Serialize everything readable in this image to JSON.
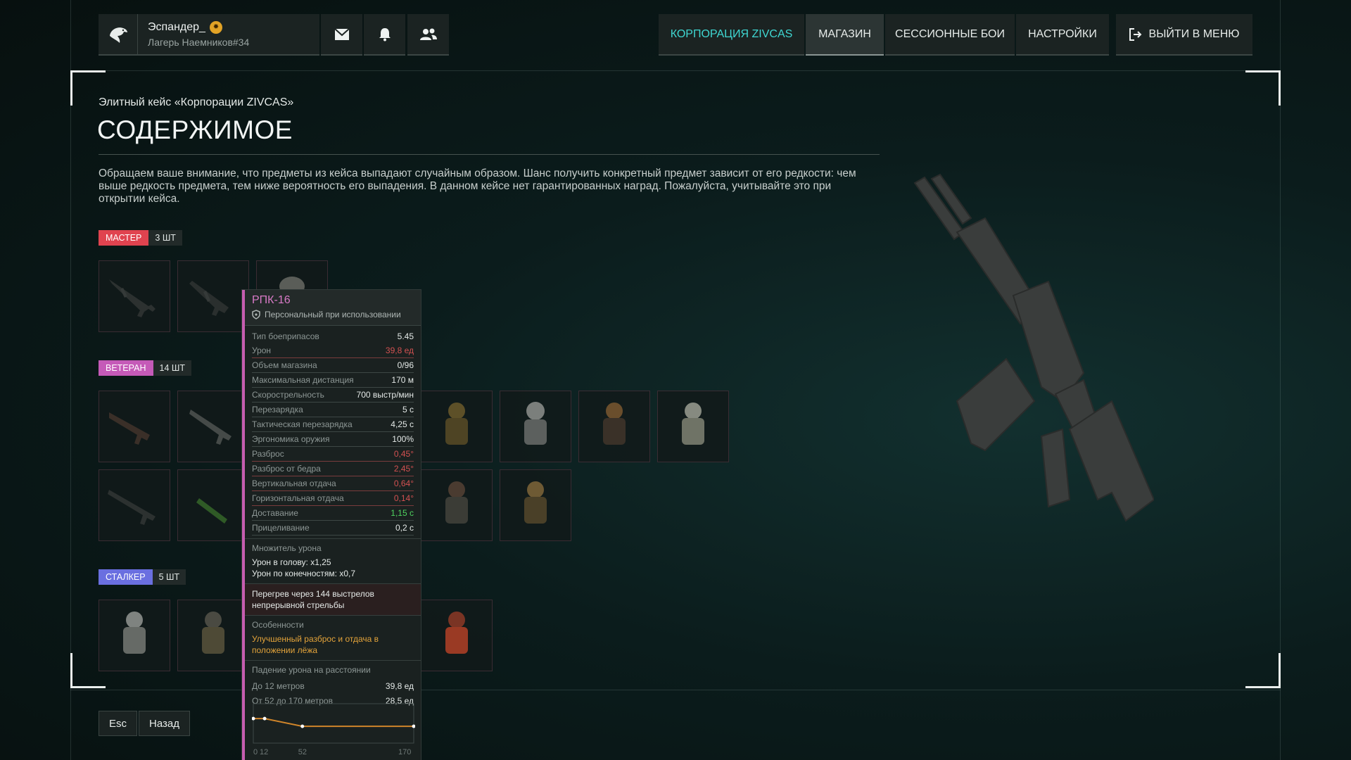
{
  "header": {
    "username": "Эспандер_",
    "camp": "Лагерь Наемников#34",
    "icons": [
      "eagle-logo",
      "mail-icon",
      "bell-icon",
      "friends-icon"
    ],
    "nav": [
      {
        "label": "КОРПОРАЦИЯ ZIVCAS",
        "accent": true,
        "active": false
      },
      {
        "label": "МАГАЗИН",
        "accent": false,
        "active": true
      },
      {
        "label": "СЕССИОННЫЕ БОИ",
        "accent": false,
        "active": false
      },
      {
        "label": "НАСТРОЙКИ",
        "accent": false,
        "active": false
      }
    ],
    "exit_label": "ВЫЙТИ В МЕНЮ"
  },
  "page": {
    "subtitle": "Элитный кейс «Корпорации ZIVCAS»",
    "title": "СОДЕРЖИМОЕ",
    "notice": "Обращаем ваше внимание, что предметы из кейса выпадают случайным образом. Шанс получить конкретный предмет зависит от его редкости: чем выше редкость предмета, тем ниже вероятность его выпадения. В данном кейсе нет гарантированных наград. Пожалуйста, учитывайте это при открытии кейса."
  },
  "rarities": {
    "master": {
      "label": "МАСТЕР",
      "count": "3 ШТ",
      "color": "#e0434f"
    },
    "veteran": {
      "label": "ВЕТЕРАН",
      "count": "14 ШТ",
      "color": "#c55ab8"
    },
    "stalker": {
      "label": "СТАЛКЕР",
      "count": "5 ШТ",
      "color": "#6a6fe0"
    }
  },
  "tooltip": {
    "name": "РПК-16",
    "personal": "Персональный при использовании",
    "stats": [
      {
        "label": "Тип боеприпасов",
        "value": "5.45",
        "state": "normal"
      },
      {
        "label": "Урон",
        "value": "39,8 ед",
        "state": "bad"
      },
      {
        "label": "Объем магазина",
        "value": "0/96",
        "state": "normal"
      },
      {
        "label": "Максимальная дистанция",
        "value": "170 м",
        "state": "normal"
      },
      {
        "label": "Скорострельность",
        "value": "700 выстр/мин",
        "state": "normal"
      },
      {
        "label": "Перезарядка",
        "value": "5 с",
        "state": "normal"
      },
      {
        "label": "Тактическая перезарядка",
        "value": "4,25 с",
        "state": "normal"
      },
      {
        "label": "Эргономика оружия",
        "value": "100%",
        "state": "normal"
      },
      {
        "label": "Разброс",
        "value": "0,45°",
        "state": "bad"
      },
      {
        "label": "Разброс от бедра",
        "value": "2,45°",
        "state": "bad"
      },
      {
        "label": "Вертикальная отдача",
        "value": "0,64°",
        "state": "bad"
      },
      {
        "label": "Горизонтальная отдача",
        "value": "0,14°",
        "state": "bad"
      },
      {
        "label": "Доставание",
        "value": "1,15 с",
        "state": "good"
      },
      {
        "label": "Прицеливание",
        "value": "0,2 с",
        "state": "normal"
      }
    ],
    "multiplier_heading": "Множитель урона",
    "head": "Урон в голову: x1,25",
    "limbs": "Урон по конечностям: x0,7",
    "overheat": "Перегрев через 144 выстрелов непрерывной стрельбы",
    "features_heading": "Особенности",
    "features": "Улучшенный разброс и отдача в положении лёжа",
    "falloff_heading": "Падение урона на расстоянии",
    "falloff_rows": [
      {
        "label": "До 12 метров",
        "value": "39,8 ед"
      },
      {
        "label": "От 52 до 170 метров",
        "value": "28,5 ед"
      }
    ],
    "falloff_ticks": [
      "0",
      "12",
      "52",
      "170"
    ],
    "falloff_points": [
      [
        0,
        39.8
      ],
      [
        12,
        39.8
      ],
      [
        52,
        28.5
      ],
      [
        170,
        28.5
      ]
    ]
  },
  "back": {
    "key": "Esc",
    "label": "Назад"
  }
}
